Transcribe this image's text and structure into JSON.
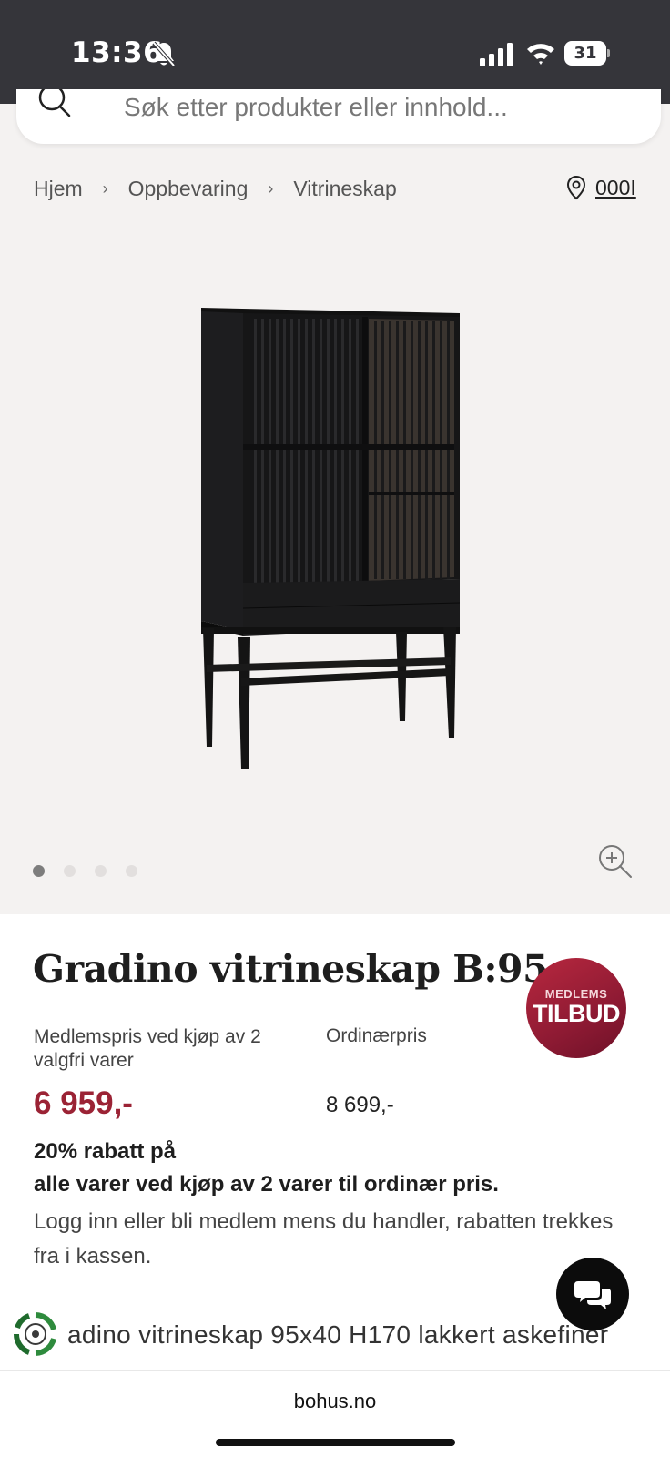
{
  "status_bar": {
    "time": "13:36",
    "battery": "31"
  },
  "search": {
    "placeholder": "Søk etter produkter eller innhold..."
  },
  "breadcrumb": {
    "items": [
      "Hjem",
      "Oppbevaring",
      "Vitrineskap"
    ],
    "separator": "›"
  },
  "store": {
    "code": "000I"
  },
  "gallery": {
    "image_count": 4,
    "active_index": 0
  },
  "product": {
    "title": "Gradino vitrineskap B:95",
    "badge_top": "MEDLEMS",
    "badge_bottom": "TILBUD",
    "member_price_label": "Medlemspris ved kjøp av 2 valgfri varer",
    "member_price": "6 959,-",
    "regular_price_label": "Ordinærpris",
    "regular_price": "8 699,-",
    "discount_line1": "20% rabatt på",
    "discount_line2": "alle varer ved kjøp av 2 varer til ordinær pris.",
    "login_text": "Logg inn eller bli medlem mens du handler, rabatten trekkes fra i kassen.",
    "description": "adino vitrineskap 95x40 H170 lakkert askefiner"
  },
  "browser": {
    "url": "bohus.no"
  },
  "colors": {
    "status_bar": "#35353a",
    "page_bg": "#f4f2f1",
    "price_red": "#9b2335",
    "badge": "#9b2335"
  }
}
